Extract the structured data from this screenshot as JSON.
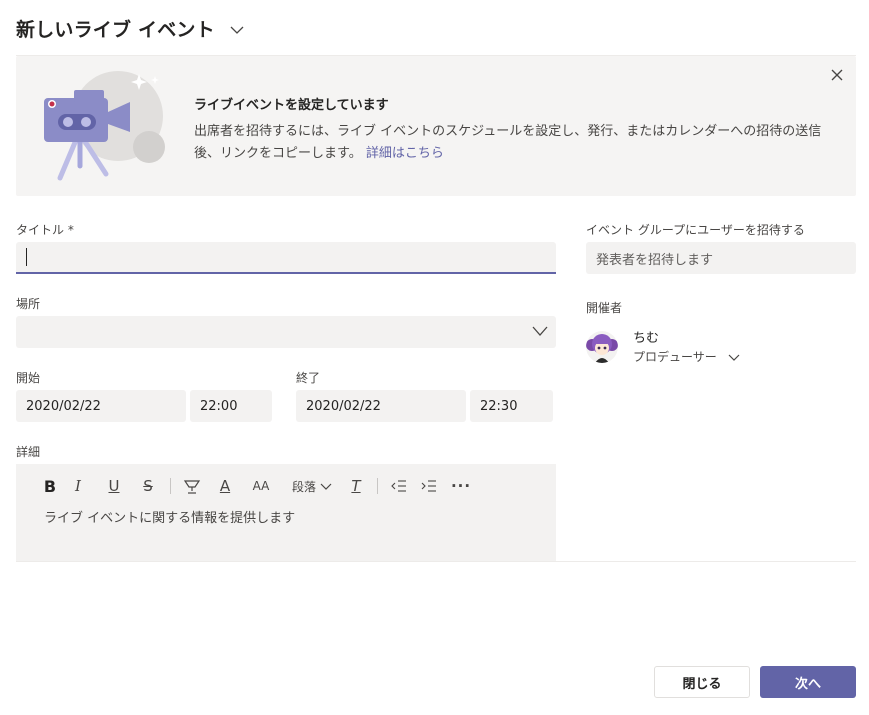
{
  "header": {
    "title": "新しいライブ イベント"
  },
  "banner": {
    "title": "ライブイベントを設定しています",
    "text": "出席者を招待するには、ライブ イベントのスケジュールを設定し、発行、またはカレンダーへの招待の送信後、リンクをコピーします。",
    "link": "詳細はこちら"
  },
  "form": {
    "title_label": "タイトル *",
    "location_label": "場所",
    "start_label": "開始",
    "end_label": "終了",
    "start_date": "2020/02/22",
    "start_time": "22:00",
    "end_date": "2020/02/22",
    "end_time": "22:30",
    "details_label": "詳細",
    "details_placeholder": "ライブ イベントに関する情報を提供します"
  },
  "toolbar": {
    "bold": "B",
    "italic": "I",
    "underline": "U",
    "strike": "S",
    "font_color": "A",
    "font_size": "AA",
    "paragraph": "段落",
    "clear": "T",
    "more": "···"
  },
  "side": {
    "invite_label": "イベント グループにユーザーを招待する",
    "invite_placeholder": "発表者を招待します",
    "organizer_label": "開催者",
    "organizer_name": "ちむ",
    "organizer_role": "プロデューサー"
  },
  "buttons": {
    "close": "閉じる",
    "next": "次へ"
  },
  "colors": {
    "accent": "#6264a7",
    "field_bg": "#f3f2f1",
    "banner_bg": "#f5f4f3"
  }
}
